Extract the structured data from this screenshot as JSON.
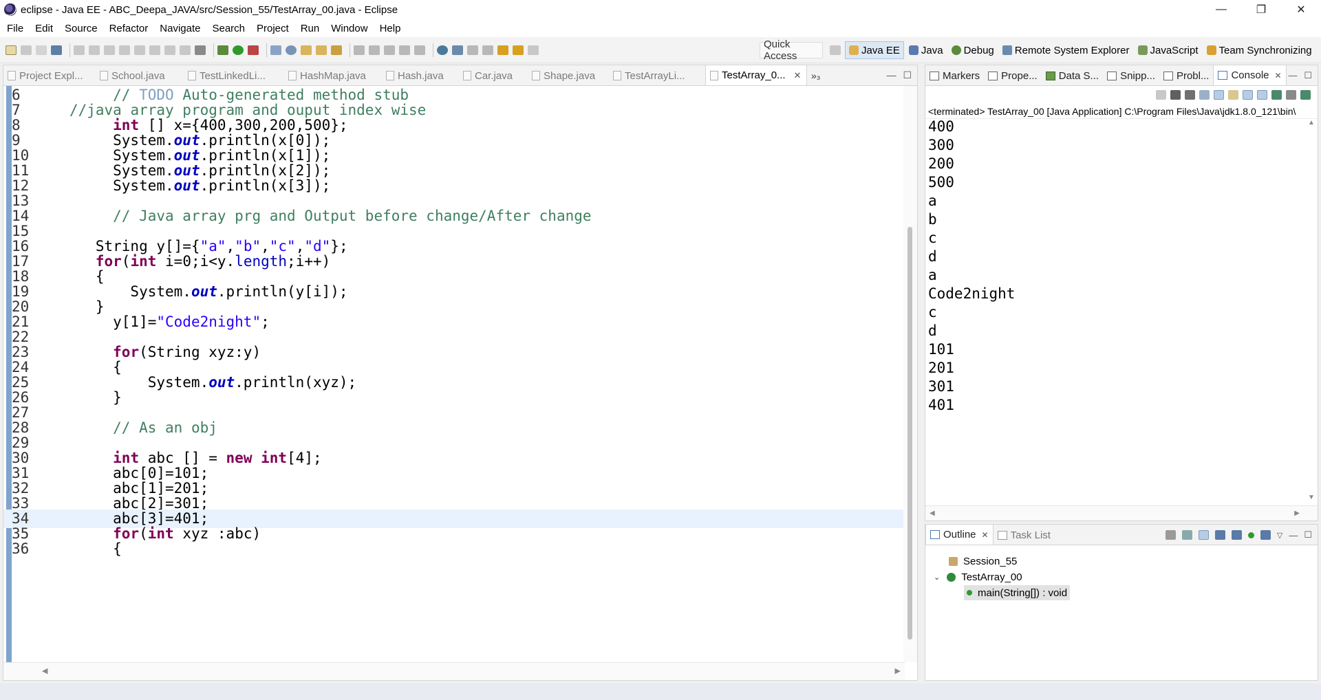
{
  "window": {
    "title": "eclipse - Java EE - ABC_Deepa_JAVA/src/Session_55/TestArray_00.java - Eclipse",
    "controls": [
      "—",
      "❐",
      "✕"
    ]
  },
  "menu": [
    {
      "label": "File"
    },
    {
      "label": "Edit"
    },
    {
      "label": "Source"
    },
    {
      "label": "Refactor"
    },
    {
      "label": "Navigate"
    },
    {
      "label": "Search"
    },
    {
      "label": "Project"
    },
    {
      "label": "Run"
    },
    {
      "label": "Window"
    },
    {
      "label": "Help"
    }
  ],
  "toolbar": {
    "quick_access": "Quick Access",
    "perspectives": [
      {
        "label": "Java EE",
        "icon": "java-ee-icon",
        "active": true
      },
      {
        "label": "Java",
        "icon": "java-icon"
      },
      {
        "label": "Debug",
        "icon": "debug-icon"
      },
      {
        "label": "Remote System Explorer",
        "icon": "remote-system-icon"
      },
      {
        "label": "JavaScript",
        "icon": "javascript-icon"
      },
      {
        "label": "Team Synchronizing",
        "icon": "team-sync-icon"
      }
    ]
  },
  "editor": {
    "tabs": [
      {
        "label": "Project Expl..."
      },
      {
        "label": "School.java"
      },
      {
        "label": "TestLinkedLi..."
      },
      {
        "label": "HashMap.java"
      },
      {
        "label": "Hash.java"
      },
      {
        "label": "Car.java"
      },
      {
        "label": "Shape.java"
      },
      {
        "label": "TestArrayLi..."
      },
      {
        "label": "TestArray_0...",
        "active": true
      }
    ],
    "overflow": "»₃",
    "line_numbers": [
      "6",
      "7",
      "8",
      "9",
      "10",
      "11",
      "12",
      "13",
      "14",
      "15",
      "16",
      "17",
      "18",
      "19",
      "20",
      "21",
      "22",
      "23",
      "24",
      "25",
      "26",
      "27",
      "28",
      "29",
      "30",
      "31",
      "32",
      "33",
      "34",
      "35",
      "36"
    ],
    "current_line": "34"
  },
  "console_view": {
    "tabs": [
      {
        "label": "Markers",
        "icon": "markers-icon"
      },
      {
        "label": "Prope...",
        "icon": "properties-icon"
      },
      {
        "label": "Data S...",
        "icon": "data-source-icon"
      },
      {
        "label": "Snipp...",
        "icon": "snippets-icon"
      },
      {
        "label": "Probl...",
        "icon": "problems-icon"
      },
      {
        "label": "Console",
        "icon": "console-icon",
        "active": true
      }
    ],
    "terminated": "<terminated> TestArray_00 [Java Application] C:\\Program Files\\Java\\jdk1.8.0_121\\bin\\",
    "output": [
      "400",
      "300",
      "200",
      "500",
      "a",
      "b",
      "c",
      "d",
      "a",
      "Code2night",
      "c",
      "d",
      "101",
      "201",
      "301",
      "401"
    ]
  },
  "outline_view": {
    "tabs": [
      {
        "label": "Outline",
        "icon": "outline-icon",
        "active": true
      },
      {
        "label": "Task List",
        "icon": "task-list-icon"
      }
    ],
    "tree": {
      "package": "Session_55",
      "class": "TestArray_00",
      "method": "main(String[]) : void"
    }
  },
  "colors": {
    "keyword": "#7f0055",
    "comment": "#3f7f5f",
    "string": "#2a00ff",
    "field": "#0000c0",
    "current_line_bg": "#e8f2fe",
    "gutter_accent": "#7fa4cf"
  }
}
